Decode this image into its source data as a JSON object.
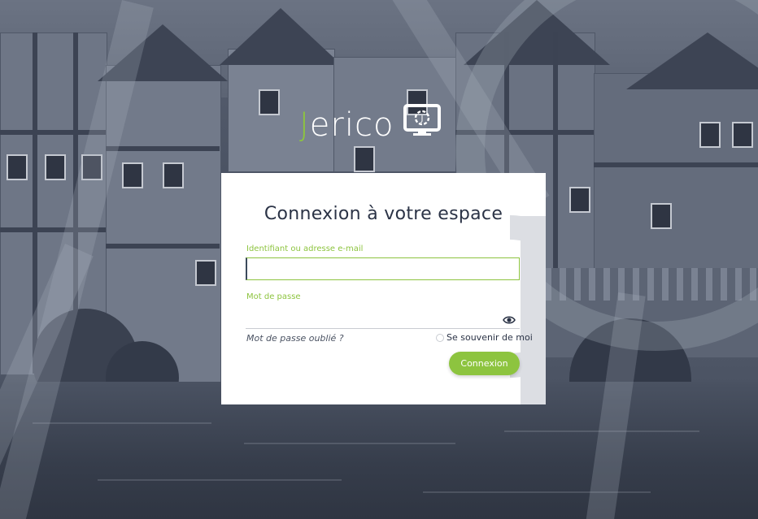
{
  "brand": {
    "logo_initial": "J",
    "logo_rest": "erico",
    "logo_icon": "monitor-gear-icon",
    "accent_color": "#8dc43f",
    "title_color": "#2b3346"
  },
  "login": {
    "title": "Connexion à votre espace",
    "username_label": "Identifiant ou adresse e-mail",
    "username_value": "",
    "password_label": "Mot de passe",
    "password_value": "",
    "show_password_icon": "eye-icon",
    "forgot_password": "Mot de passe oublié ?",
    "remember_me": "Se souvenir de moi",
    "remember_checked": false,
    "submit_label": "Connexion"
  }
}
